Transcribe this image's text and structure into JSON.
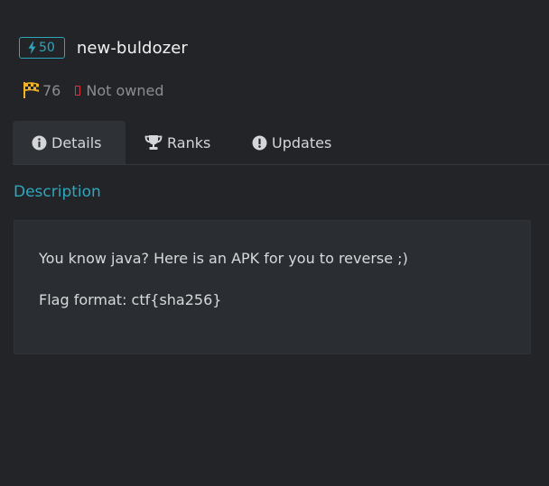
{
  "challenge": {
    "points": "50",
    "title": "new-buldozer",
    "solves": "76",
    "ownership": "Not owned"
  },
  "tabs": [
    {
      "label": "Details",
      "icon": "info-circle-icon",
      "active": true
    },
    {
      "label": "Ranks",
      "icon": "trophy-icon",
      "active": false
    },
    {
      "label": "Updates",
      "icon": "exclamation-circle-icon",
      "active": false
    }
  ],
  "description": {
    "heading": "Description",
    "lines": [
      "You know java? Here is an APK for you to reverse ;)",
      "Flag format: ctf{sha256}"
    ]
  },
  "colors": {
    "background": "#222428",
    "accent": "#2ea7bd",
    "flag": "#f0b429",
    "not_owned": "#dc3545",
    "card": "#2a2d31"
  }
}
